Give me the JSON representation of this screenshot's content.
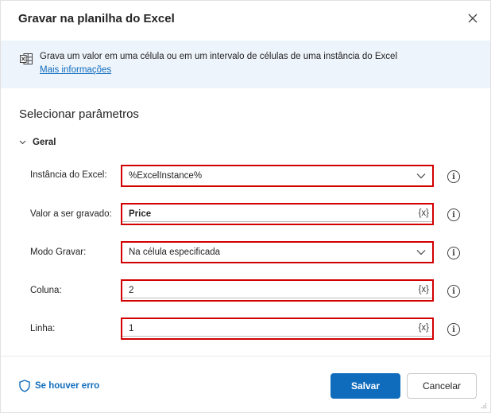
{
  "dialog": {
    "title": "Gravar na planilha do Excel",
    "close_icon": "close-icon"
  },
  "info": {
    "icon": "excel-icon",
    "description": "Grava um valor em uma célula ou em um intervalo de células de uma instância do Excel",
    "link": "Mais informações"
  },
  "section_title": "Selecionar parâmetros",
  "group": {
    "label": "Geral",
    "expanded": true
  },
  "fields": [
    {
      "label": "Instância do Excel:",
      "value": "%ExcelInstance%",
      "kind": "dropdown",
      "bold": false
    },
    {
      "label": "Valor a ser gravado:",
      "value": "Price",
      "kind": "text-variable",
      "bold": true
    },
    {
      "label": "Modo Gravar:",
      "value": "Na célula especificada",
      "kind": "dropdown",
      "bold": false
    },
    {
      "label": "Coluna:",
      "value": "2",
      "kind": "text-variable",
      "bold": false
    },
    {
      "label": "Linha:",
      "value": "1",
      "kind": "text-variable",
      "bold": false
    }
  ],
  "variable_button": "{x}",
  "help_glyph": "i",
  "footer": {
    "error_link": "Se houver erro",
    "save": "Salvar",
    "cancel": "Cancelar"
  },
  "colors": {
    "accent": "#0f6cbd",
    "highlight": "#d20000",
    "banner": "#eef4fb"
  }
}
